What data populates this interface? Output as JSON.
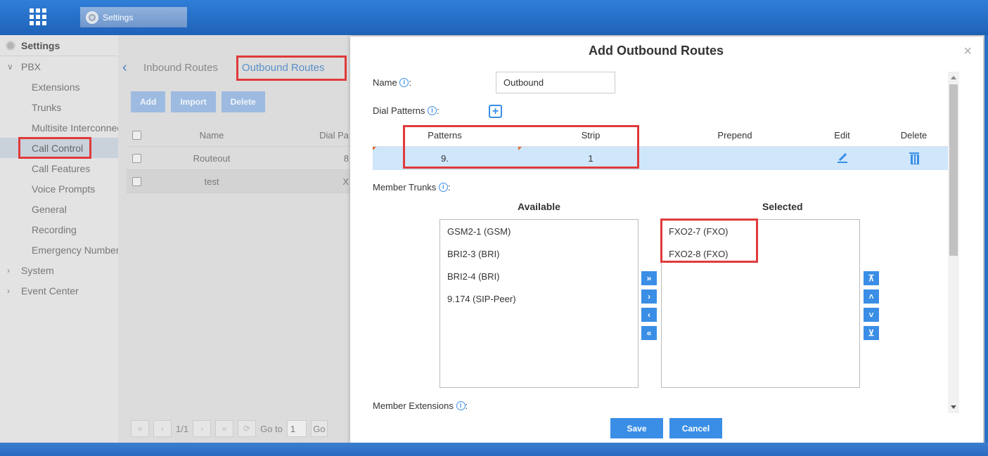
{
  "topbar": {
    "app_tab_label": "Settings"
  },
  "sidebar": {
    "header": "Settings",
    "pbx_label": "PBX",
    "items": [
      "Extensions",
      "Trunks",
      "Multisite Interconnect",
      "Call Control",
      "Call Features",
      "Voice Prompts",
      "General",
      "Recording",
      "Emergency Number"
    ],
    "system_label": "System",
    "event_center_label": "Event Center"
  },
  "content": {
    "tabs": [
      "Inbound Routes",
      "Outbound Routes"
    ],
    "toolbar": [
      "Add",
      "Import",
      "Delete"
    ],
    "grid_headers": {
      "name": "Name",
      "dial": "Dial Pa"
    },
    "rows": [
      {
        "name": "Routeout",
        "dial": "8"
      },
      {
        "name": "test",
        "dial": "X"
      }
    ],
    "pager": {
      "page": "1/1",
      "goto_label": "Go to",
      "goto_value": "1",
      "go": "Go"
    }
  },
  "modal": {
    "title": "Add Outbound Routes",
    "close": "×",
    "name_label": "Name",
    "name_value": "Outbound",
    "dial_patterns_label": "Dial Patterns",
    "pattern_headers": {
      "patterns": "Patterns",
      "strip": "Strip",
      "prepend": "Prepend",
      "edit": "Edit",
      "delete": "Delete"
    },
    "pattern_row": {
      "patterns": "9.",
      "strip": "1",
      "prepend": ""
    },
    "member_trunks_label": "Member Trunks",
    "available_title": "Available",
    "selected_title": "Selected",
    "available": [
      "GSM2-1 (GSM)",
      "BRI2-3 (BRI)",
      "BRI2-4 (BRI)",
      "9.174 (SIP-Peer)"
    ],
    "selected": [
      "FXO2-7 (FXO)",
      "FXO2-8 (FXO)"
    ],
    "member_extensions_label": "Member Extensions",
    "save": "Save",
    "cancel": "Cancel"
  },
  "colors": {
    "accent": "#3a8ee6",
    "highlight_box": "#e03a3a",
    "row_selected": "#cfe6fb"
  }
}
